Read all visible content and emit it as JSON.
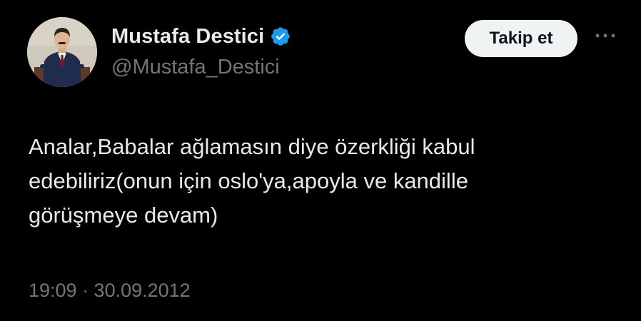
{
  "author": {
    "display_name": "Mustafa Destici",
    "handle": "@Mustafa_Destici",
    "verified": true,
    "verified_color": "#1d9bf0"
  },
  "actions": {
    "follow_label": "Takip et",
    "more_icon": "more-horizontal-icon"
  },
  "tweet": {
    "text": "Analar,Babalar ağlamasın diye özerkliği kabul\nedebiliriz(onun için oslo'ya,apoyla ve kandille\ngörüşmeye devam)",
    "timestamp": "19:09 · 30.09.2012"
  },
  "colors": {
    "background": "#000000",
    "primary_text": "#e7e9ea",
    "secondary_text": "#71767b",
    "button_bg": "#eff3f4",
    "button_text": "#0f1419"
  }
}
